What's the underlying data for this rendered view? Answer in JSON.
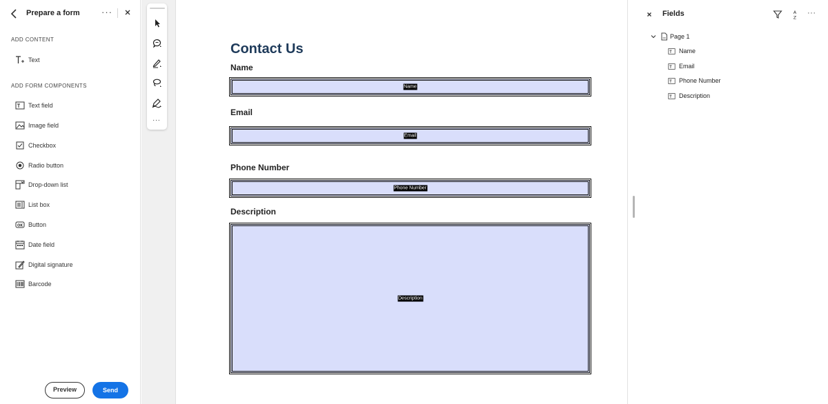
{
  "left_panel": {
    "title": "Prepare a form",
    "more_label": "···",
    "add_content_heading": "ADD CONTENT",
    "add_content_items": [
      {
        "label": "Text",
        "icon": "text-add-icon"
      }
    ],
    "form_components_heading": "ADD FORM COMPONENTS",
    "form_components": [
      {
        "label": "Text field",
        "icon": "text-field-icon"
      },
      {
        "label": "Image field",
        "icon": "image-field-icon"
      },
      {
        "label": "Checkbox",
        "icon": "checkbox-icon"
      },
      {
        "label": "Radio button",
        "icon": "radio-button-icon"
      },
      {
        "label": "Drop-down list",
        "icon": "dropdown-list-icon"
      },
      {
        "label": "List box",
        "icon": "list-box-icon"
      },
      {
        "label": "Button",
        "icon": "button-ok-icon"
      },
      {
        "label": "Date field",
        "icon": "date-field-icon"
      },
      {
        "label": "Digital signature",
        "icon": "digital-signature-icon"
      },
      {
        "label": "Barcode",
        "icon": "barcode-icon"
      }
    ],
    "preview_label": "Preview",
    "send_label": "Send"
  },
  "toolbar": {
    "tools": [
      "select-cursor-icon",
      "comment-icon",
      "pen-icon",
      "lasso-icon",
      "fill-sign-icon"
    ],
    "more_label": "···"
  },
  "document": {
    "title": "Contact Us",
    "fields": [
      {
        "label": "Name",
        "tag": "Name"
      },
      {
        "label": "Email",
        "tag": "Email"
      },
      {
        "label": "Phone Number",
        "tag": "Phone Number"
      },
      {
        "label": "Description",
        "tag": "Description"
      }
    ]
  },
  "right_panel": {
    "title": "Fields",
    "more_label": "···",
    "tree": {
      "page_label": "Page 1",
      "items": [
        "Name",
        "Email",
        "Phone Number",
        "Description"
      ]
    }
  },
  "colors": {
    "accent": "#1473e6",
    "field_fill": "#d9defb",
    "title_color": "#1e3a5a"
  }
}
